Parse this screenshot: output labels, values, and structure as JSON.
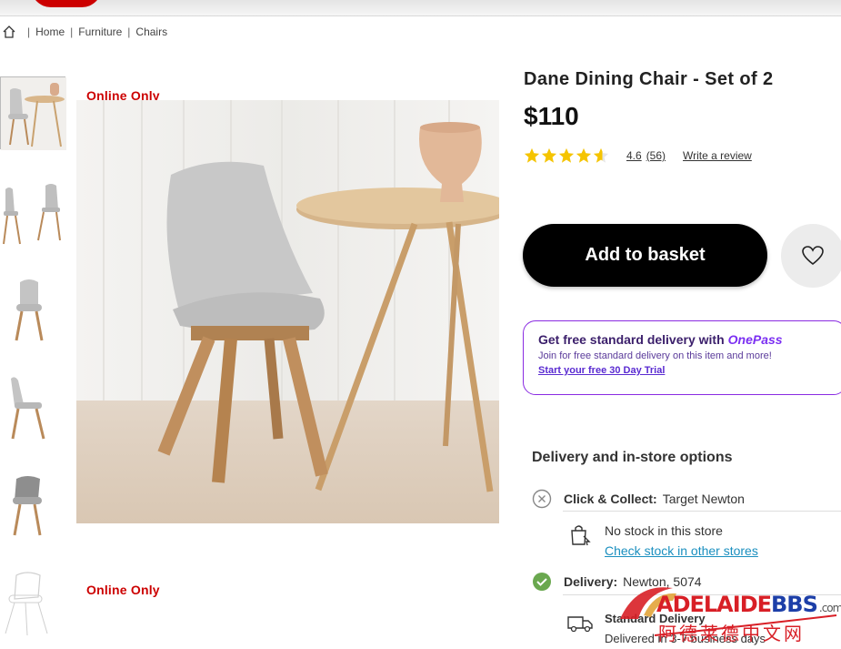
{
  "breadcrumb": {
    "items": [
      "Home",
      "Furniture",
      "Chairs"
    ],
    "separator": "|"
  },
  "badges": {
    "online_only_top": "Online Only",
    "online_only_bottom": "Online Only"
  },
  "product": {
    "title": "Dane Dining Chair - Set of 2",
    "price": "$110",
    "rating_value": "4.6",
    "rating_count": "(56)",
    "stars_filled": 4.6,
    "write_review": "Write a review"
  },
  "actions": {
    "add_to_basket": "Add to basket"
  },
  "onepass": {
    "headline": "Get free standard delivery with",
    "brand": "OnePass",
    "subtext": "Join for free standard delivery on this item and more!",
    "trial_link": "Start your free 30 Day Trial"
  },
  "delivery": {
    "heading": "Delivery and in-store options",
    "click_collect_label": "Click & Collect:",
    "click_collect_store": "Target Newton",
    "no_stock": "No stock in this store",
    "check_stock_link": "Check stock in other stores",
    "delivery_label": "Delivery:",
    "delivery_location": "Newton, 5074",
    "standard_title": "Standard Delivery",
    "standard_eta": "Delivered in 3-7 business days"
  },
  "watermark": {
    "brand_red": "ADELAIDE",
    "brand_blue": "BBS",
    "suffix": ".com",
    "chinese": "阿德莱德中文网"
  },
  "colors": {
    "accent_red": "#cc0000",
    "onepass_purple": "#8a2be2",
    "link_blue": "#1a8fbf",
    "star_yellow": "#f5c400",
    "success_green": "#6aa84f"
  },
  "icons": [
    "home-icon",
    "heart-icon",
    "x-circle-icon",
    "check-circle-icon",
    "click-collect-icon",
    "truck-icon",
    "star-icon"
  ]
}
